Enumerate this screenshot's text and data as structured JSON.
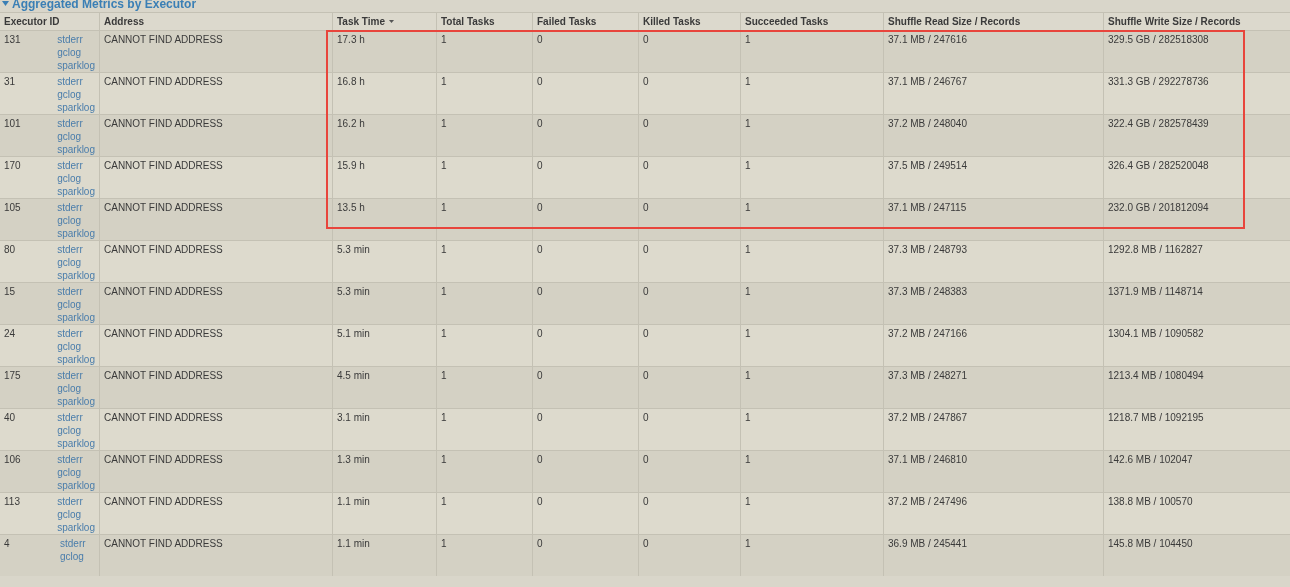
{
  "section": {
    "title": "Aggregated Metrics by Executor"
  },
  "table": {
    "columns": [
      {
        "label": "Executor ID",
        "sorted": false
      },
      {
        "label": "Address",
        "sorted": false
      },
      {
        "label": "Task Time",
        "sorted": true
      },
      {
        "label": "Total Tasks",
        "sorted": false
      },
      {
        "label": "Failed Tasks",
        "sorted": false
      },
      {
        "label": "Killed Tasks",
        "sorted": false
      },
      {
        "label": "Succeeded Tasks",
        "sorted": false
      },
      {
        "label": "Shuffle Read Size / Records",
        "sorted": false
      },
      {
        "label": "Shuffle Write Size / Records",
        "sorted": false
      }
    ],
    "rows": [
      {
        "id": "131",
        "links": [
          "stderr",
          "gclog",
          "sparklog"
        ],
        "address": "CANNOT FIND ADDRESS",
        "task_time": "17.3 h",
        "total": "1",
        "failed": "0",
        "killed": "0",
        "succeeded": "1",
        "shuffle_read": "37.1 MB / 247616",
        "shuffle_write": "329.5 GB / 282518308",
        "highlighted": true
      },
      {
        "id": "31",
        "links": [
          "stderr",
          "gclog",
          "sparklog"
        ],
        "address": "CANNOT FIND ADDRESS",
        "task_time": "16.8 h",
        "total": "1",
        "failed": "0",
        "killed": "0",
        "succeeded": "1",
        "shuffle_read": "37.1 MB / 246767",
        "shuffle_write": "331.3 GB / 292278736",
        "highlighted": true
      },
      {
        "id": "101",
        "links": [
          "stderr",
          "gclog",
          "sparklog"
        ],
        "address": "CANNOT FIND ADDRESS",
        "task_time": "16.2 h",
        "total": "1",
        "failed": "0",
        "killed": "0",
        "succeeded": "1",
        "shuffle_read": "37.2 MB / 248040",
        "shuffle_write": "322.4 GB / 282578439",
        "highlighted": true
      },
      {
        "id": "170",
        "links": [
          "stderr",
          "gclog",
          "sparklog"
        ],
        "address": "CANNOT FIND ADDRESS",
        "task_time": "15.9 h",
        "total": "1",
        "failed": "0",
        "killed": "0",
        "succeeded": "1",
        "shuffle_read": "37.5 MB / 249514",
        "shuffle_write": "326.4 GB / 282520048",
        "highlighted": true
      },
      {
        "id": "105",
        "links": [
          "stderr",
          "gclog",
          "sparklog"
        ],
        "address": "CANNOT FIND ADDRESS",
        "task_time": "13.5 h",
        "total": "1",
        "failed": "0",
        "killed": "0",
        "succeeded": "1",
        "shuffle_read": "37.1 MB / 247115",
        "shuffle_write": "232.0 GB / 201812094",
        "highlighted": true
      },
      {
        "id": "80",
        "links": [
          "stderr",
          "gclog",
          "sparklog"
        ],
        "address": "CANNOT FIND ADDRESS",
        "task_time": "5.3 min",
        "total": "1",
        "failed": "0",
        "killed": "0",
        "succeeded": "1",
        "shuffle_read": "37.3 MB / 248793",
        "shuffle_write": "1292.8 MB / 1162827",
        "highlighted": false
      },
      {
        "id": "15",
        "links": [
          "stderr",
          "gclog",
          "sparklog"
        ],
        "address": "CANNOT FIND ADDRESS",
        "task_time": "5.3 min",
        "total": "1",
        "failed": "0",
        "killed": "0",
        "succeeded": "1",
        "shuffle_read": "37.3 MB / 248383",
        "shuffle_write": "1371.9 MB / 1148714",
        "highlighted": false
      },
      {
        "id": "24",
        "links": [
          "stderr",
          "gclog",
          "sparklog"
        ],
        "address": "CANNOT FIND ADDRESS",
        "task_time": "5.1 min",
        "total": "1",
        "failed": "0",
        "killed": "0",
        "succeeded": "1",
        "shuffle_read": "37.2 MB / 247166",
        "shuffle_write": "1304.1 MB / 1090582",
        "highlighted": false
      },
      {
        "id": "175",
        "links": [
          "stderr",
          "gclog",
          "sparklog"
        ],
        "address": "CANNOT FIND ADDRESS",
        "task_time": "4.5 min",
        "total": "1",
        "failed": "0",
        "killed": "0",
        "succeeded": "1",
        "shuffle_read": "37.3 MB / 248271",
        "shuffle_write": "1213.4 MB / 1080494",
        "highlighted": false
      },
      {
        "id": "40",
        "links": [
          "stderr",
          "gclog",
          "sparklog"
        ],
        "address": "CANNOT FIND ADDRESS",
        "task_time": "3.1 min",
        "total": "1",
        "failed": "0",
        "killed": "0",
        "succeeded": "1",
        "shuffle_read": "37.2 MB / 247867",
        "shuffle_write": "1218.7 MB / 1092195",
        "highlighted": false
      },
      {
        "id": "106",
        "links": [
          "stderr",
          "gclog",
          "sparklog"
        ],
        "address": "CANNOT FIND ADDRESS",
        "task_time": "1.3 min",
        "total": "1",
        "failed": "0",
        "killed": "0",
        "succeeded": "1",
        "shuffle_read": "37.1 MB / 246810",
        "shuffle_write": "142.6 MB / 102047",
        "highlighted": false
      },
      {
        "id": "113",
        "links": [
          "stderr",
          "gclog",
          "sparklog"
        ],
        "address": "CANNOT FIND ADDRESS",
        "task_time": "1.1 min",
        "total": "1",
        "failed": "0",
        "killed": "0",
        "succeeded": "1",
        "shuffle_read": "37.2 MB / 247496",
        "shuffle_write": "138.8 MB / 100570",
        "highlighted": false
      },
      {
        "id": "4",
        "links": [
          "stderr",
          "gclog"
        ],
        "address": "CANNOT FIND ADDRESS",
        "task_time": "1.1 min",
        "total": "1",
        "failed": "0",
        "killed": "0",
        "succeeded": "1",
        "shuffle_read": "36.9 MB / 245441",
        "shuffle_write": "145.8 MB / 104450",
        "highlighted": false
      }
    ]
  }
}
